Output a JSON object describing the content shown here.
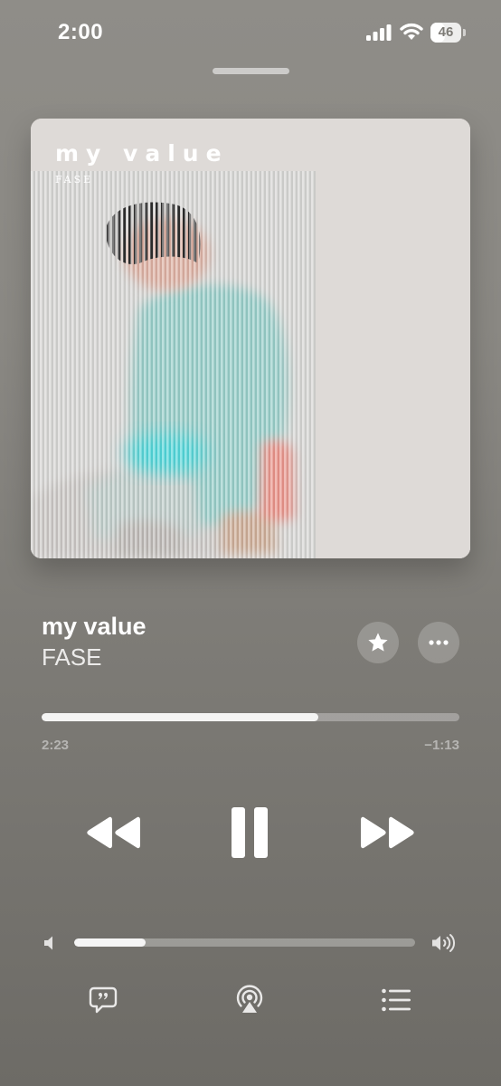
{
  "status_bar": {
    "time": "2:00",
    "battery_level": "46",
    "battery_fraction": 0.46,
    "icons": [
      "signal-icon",
      "wifi-icon",
      "battery-icon"
    ]
  },
  "artwork": {
    "title_text": "my value",
    "artist_text": "FASE"
  },
  "track": {
    "title": "my value",
    "artist": "FASE"
  },
  "playback": {
    "elapsed": "2:23",
    "remaining": "−1:13",
    "progress_fraction": 0.663
  },
  "volume": {
    "level_fraction": 0.21
  },
  "controls": {
    "icons": [
      "rewind-icon",
      "pause-icon",
      "fast-forward-icon",
      "star-icon",
      "more-icon",
      "volume-low-icon",
      "volume-high-icon",
      "lyrics-icon",
      "airplay-icon",
      "queue-icon"
    ]
  },
  "colors": {
    "background_top": "#8f8d88",
    "background_bottom": "#6d6b66",
    "artwork_bg": "#dedad7",
    "figure_shirt": "#8ec9c4",
    "accent_cyan": "#3fd4d8",
    "accent_coral": "#e88a80"
  }
}
